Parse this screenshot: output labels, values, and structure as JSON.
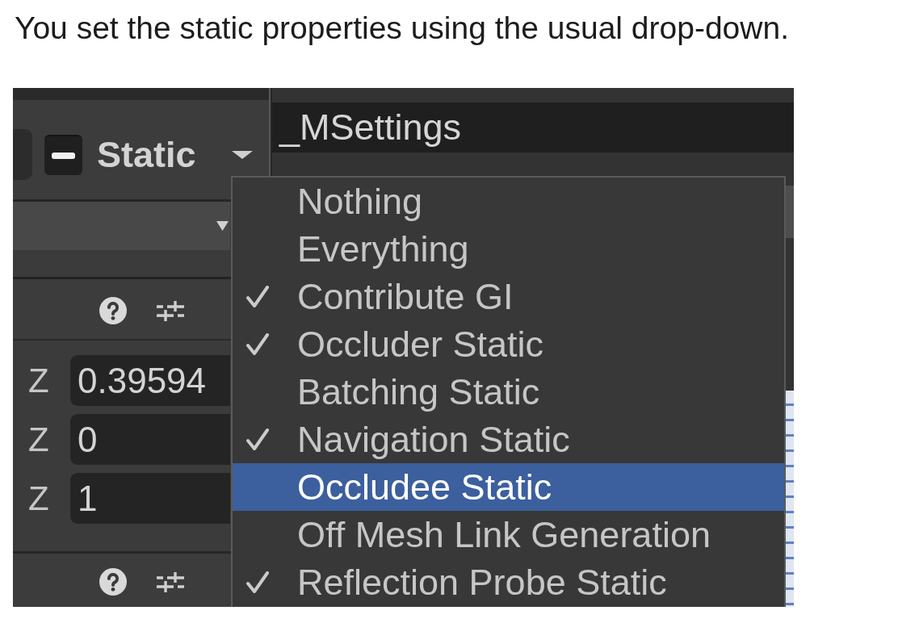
{
  "caption": "You set the static properties using the usual drop-down.",
  "editor": {
    "static_checkbox": {
      "mixed": true
    },
    "static_dropdown": {
      "label": "Static"
    },
    "name_field": {
      "value": "_MSettings"
    },
    "z_fields": [
      {
        "label": "Z",
        "value": "0.39594"
      },
      {
        "label": "Z",
        "value": "0"
      },
      {
        "label": "Z",
        "value": "1"
      }
    ],
    "static_menu": {
      "items": [
        {
          "label": "Nothing",
          "checked": false,
          "selected": false
        },
        {
          "label": "Everything",
          "checked": false,
          "selected": false
        },
        {
          "label": "Contribute GI",
          "checked": true,
          "selected": false
        },
        {
          "label": "Occluder Static",
          "checked": true,
          "selected": false
        },
        {
          "label": "Batching Static",
          "checked": false,
          "selected": false
        },
        {
          "label": "Navigation Static",
          "checked": true,
          "selected": false
        },
        {
          "label": "Occludee Static",
          "checked": false,
          "selected": true
        },
        {
          "label": "Off Mesh Link Generation",
          "checked": false,
          "selected": false
        },
        {
          "label": "Reflection Probe Static",
          "checked": true,
          "selected": false
        }
      ]
    }
  }
}
